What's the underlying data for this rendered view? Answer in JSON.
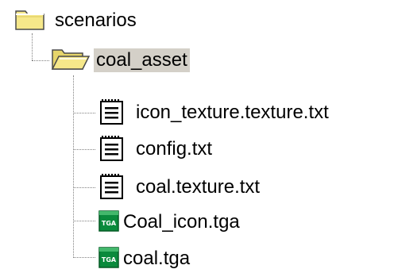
{
  "tree": {
    "root": {
      "label": "scenarios",
      "icon": "folder-closed-icon"
    },
    "folder": {
      "label": "coal_asset",
      "icon": "folder-open-icon",
      "selected": true
    },
    "files": [
      {
        "label": "icon_texture.texture.txt",
        "icon": "text-file-icon"
      },
      {
        "label": "config.txt",
        "icon": "text-file-icon"
      },
      {
        "label": "coal.texture.txt",
        "icon": "text-file-icon"
      },
      {
        "label": "Coal_icon.tga",
        "icon": "tga-file-icon"
      },
      {
        "label": "coal.tga",
        "icon": "tga-file-icon"
      }
    ]
  },
  "colors": {
    "folder_yellow": "#f6e88a",
    "selection_gray": "#d4d0c8",
    "tga_green": "#0a8a3c",
    "tree_lines": "#808080"
  }
}
